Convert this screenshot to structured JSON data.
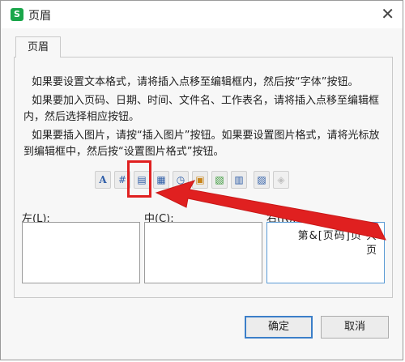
{
  "window": {
    "title": "页眉",
    "app_icon_letter": "S"
  },
  "tab": {
    "label": "页眉"
  },
  "instructions": [
    "如果要设置文本格式，请将插入点移至编辑框内，然后按“字体”按钮。",
    "如果要加入页码、日期、时间、文件名、工作表名，请将插入点移至编辑框内，然后选择相应按钮。",
    "如果要插入图片，请按“插入图片”按钮。如果要设置图片格式，请将光标放到编辑框中，然后按“设置图片格式”按钮。"
  ],
  "toolbar": {
    "buttons": [
      {
        "icon": "font-icon",
        "glyph": "A"
      },
      {
        "icon": "page-number-icon",
        "glyph": "#"
      },
      {
        "icon": "total-pages-icon",
        "glyph": "▤"
      },
      {
        "icon": "date-icon",
        "glyph": "▦"
      },
      {
        "icon": "time-icon",
        "glyph": "◷"
      },
      {
        "icon": "file-path-icon",
        "glyph": "▣"
      },
      {
        "icon": "file-name-icon",
        "glyph": "▧"
      },
      {
        "icon": "sheet-name-icon",
        "glyph": "▥"
      },
      {
        "icon": "insert-picture-icon",
        "glyph": "▨"
      },
      {
        "icon": "format-picture-icon",
        "glyph": "◈"
      }
    ]
  },
  "sections": {
    "left": {
      "label": "左(L):",
      "value": ""
    },
    "center": {
      "label": "中(C):",
      "value": ""
    },
    "right": {
      "label": "右(R):",
      "value_line1": "第&[页码]页 共",
      "value_line2": "页"
    }
  },
  "buttons": {
    "ok": "确定",
    "cancel": "取消"
  },
  "annotation": {
    "color": "#e02020"
  }
}
